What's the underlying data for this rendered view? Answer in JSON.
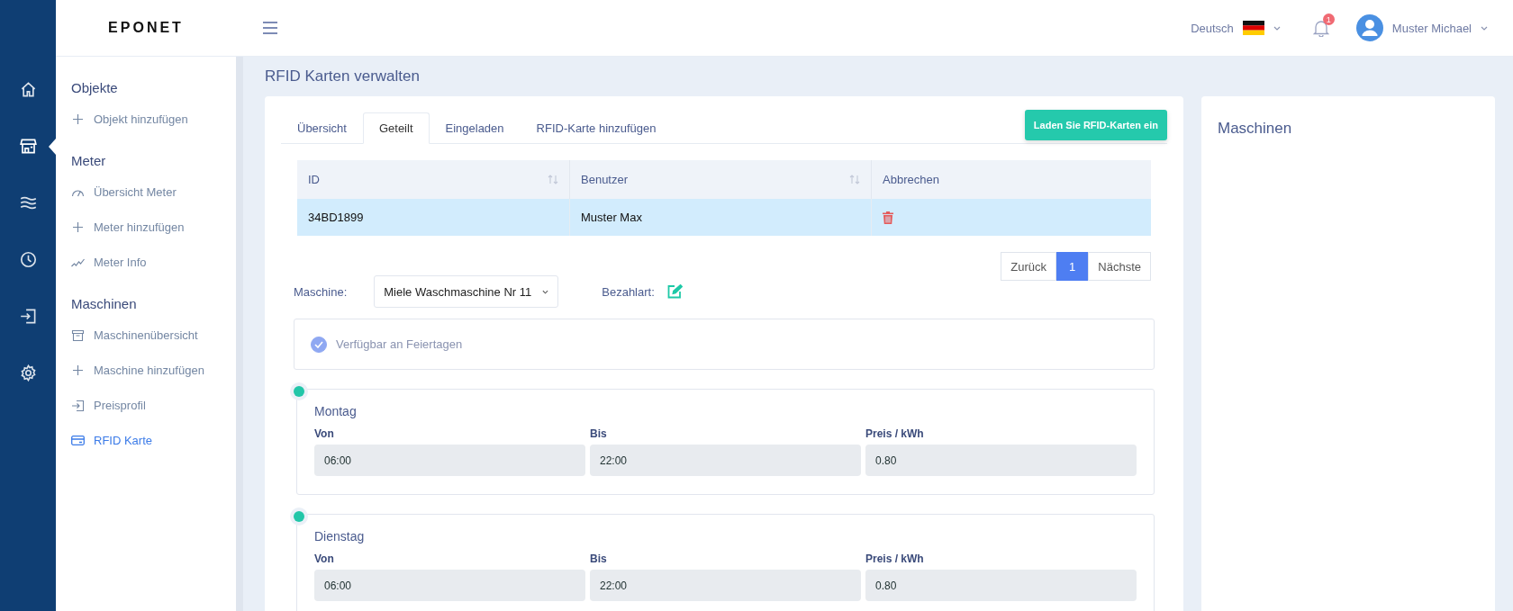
{
  "logo": "EPONET",
  "rail": [
    {
      "kind": "home",
      "selected": false
    },
    {
      "kind": "store",
      "selected": true
    },
    {
      "kind": "waves",
      "selected": false
    },
    {
      "kind": "clock",
      "selected": false
    },
    {
      "kind": "signin",
      "selected": false
    },
    {
      "kind": "gear",
      "selected": false
    }
  ],
  "sidebar": {
    "sections": [
      {
        "title": "Objekte",
        "items": [
          {
            "kind": "plus",
            "label": "Objekt hinzufügen",
            "selected": false
          }
        ]
      },
      {
        "title": "Meter",
        "items": [
          {
            "kind": "gauge",
            "label": "Übersicht Meter",
            "selected": false
          },
          {
            "kind": "plus",
            "label": "Meter hinzufügen",
            "selected": false
          },
          {
            "kind": "chart",
            "label": "Meter Info",
            "selected": false
          }
        ]
      },
      {
        "title": "Maschinen",
        "items": [
          {
            "kind": "archive",
            "label": "Maschinenübersicht",
            "selected": false
          },
          {
            "kind": "plus",
            "label": "Maschine hinzufügen",
            "selected": false
          },
          {
            "kind": "signin",
            "label": "Preisprofil",
            "selected": false
          },
          {
            "kind": "card",
            "label": "RFID Karte",
            "selected": true
          }
        ]
      }
    ]
  },
  "header": {
    "language": "Deutsch",
    "notifications": "1",
    "user": "Muster Michael"
  },
  "page_title": "RFID Karten verwalten",
  "tabs": [
    {
      "label": "Übersicht",
      "selected": false
    },
    {
      "label": "Geteilt",
      "selected": true
    },
    {
      "label": "Eingeladen",
      "selected": false
    },
    {
      "label": "RFID-Karte hinzufügen",
      "selected": false
    }
  ],
  "upload_button": "Laden Sie RFID-Karten ein",
  "table": {
    "columns": [
      {
        "label": "ID",
        "sortable": true
      },
      {
        "label": "Benutzer",
        "sortable": true
      },
      {
        "label": "Abbrechen",
        "sortable": false
      }
    ],
    "rows": [
      {
        "id": "34BD1899",
        "user": "Muster Max",
        "selected": true
      }
    ]
  },
  "pagination": {
    "prev": "Zurück",
    "pages": [
      {
        "label": "1",
        "selected": true
      }
    ],
    "next": "Nächste"
  },
  "machine": {
    "label": "Maschine:",
    "value": "Miele Waschmaschine Nr 11",
    "payment_label": "Bezahlart:"
  },
  "holiday": {
    "label": "Verfügbar an Feiertagen",
    "checked": true
  },
  "days": [
    {
      "name": "Montag",
      "fields": [
        {
          "label": "Von",
          "value": "06:00"
        },
        {
          "label": "Bis",
          "value": "22:00"
        },
        {
          "label": "Preis / kWh",
          "value": "0.80"
        }
      ]
    },
    {
      "name": "Dienstag",
      "fields": [
        {
          "label": "Von",
          "value": "06:00"
        },
        {
          "label": "Bis",
          "value": "22:00"
        },
        {
          "label": "Preis / kWh",
          "value": "0.80"
        }
      ]
    }
  ],
  "side_panel": {
    "title": "Maschinen"
  }
}
